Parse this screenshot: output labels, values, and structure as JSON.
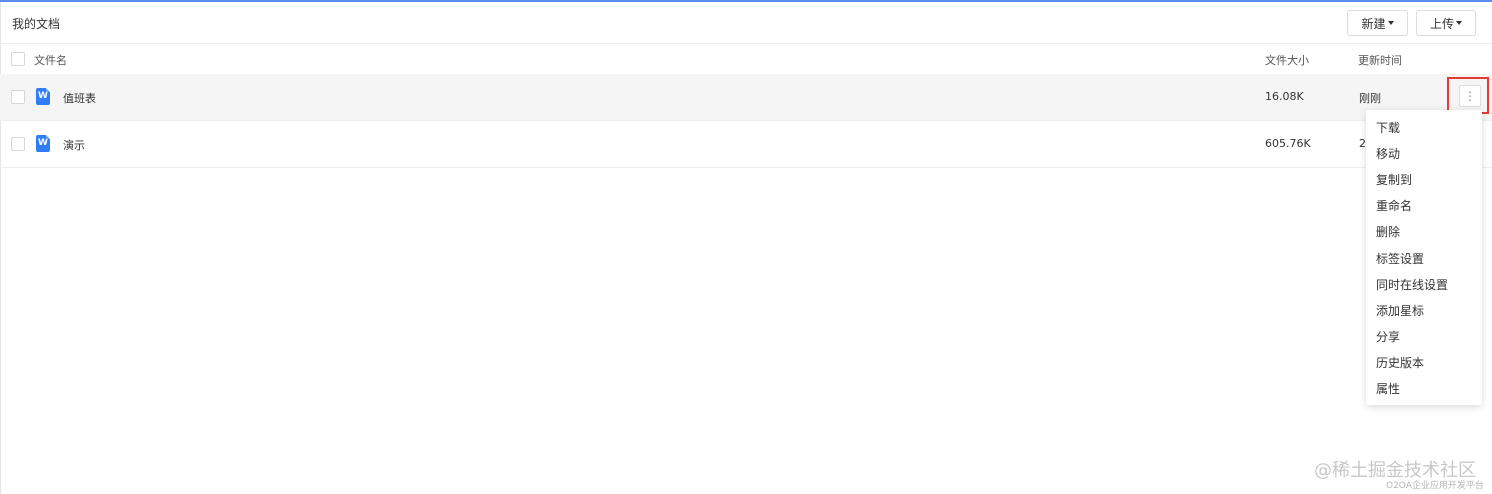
{
  "header": {
    "title": "我的文档",
    "new_button": "新建",
    "upload_button": "上传"
  },
  "table": {
    "columns": {
      "name": "文件名",
      "size": "文件大小",
      "updated": "更新时间"
    },
    "rows": [
      {
        "name": "值班表",
        "size": "16.08K",
        "updated": "刚刚",
        "icon": "word-doc-icon"
      },
      {
        "name": "演示",
        "size": "605.76K",
        "updated": "2",
        "icon": "word-doc-icon"
      }
    ]
  },
  "context_menu": {
    "items": [
      "下载",
      "移动",
      "复制到",
      "重命名",
      "删除",
      "标签设置",
      "同时在线设置",
      "添加星标",
      "分享",
      "历史版本",
      "属性"
    ]
  },
  "watermark": {
    "main": "@稀土掘金技术社区",
    "sub": "O2OA企业应用开发平台"
  },
  "colors": {
    "accent": "#5b8df0",
    "doc_icon": "#2f7ef5",
    "highlight_box": "#e53935"
  }
}
